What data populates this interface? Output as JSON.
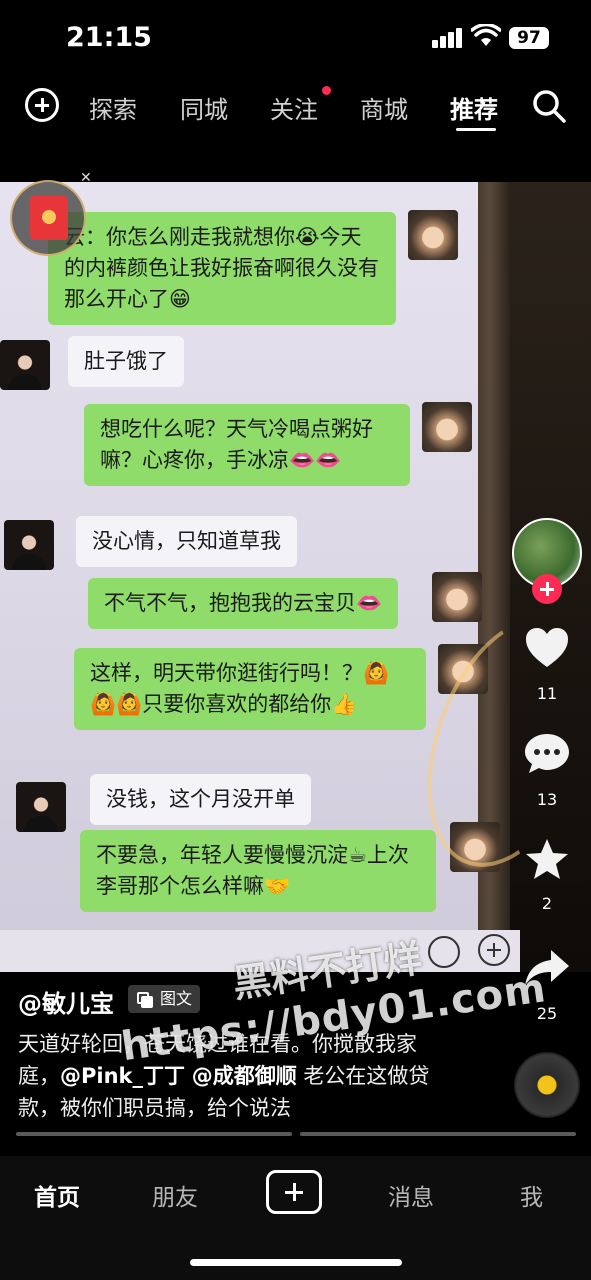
{
  "status_bar": {
    "time": "21:15",
    "battery": "97"
  },
  "top_nav": {
    "tabs": [
      "探索",
      "同城",
      "关注",
      "商城",
      "推荐"
    ],
    "active_tab": "推荐"
  },
  "chat": {
    "messages": [
      {
        "side": "right",
        "text": "云：你怎么刚走我就想你😭今天的内裤颜色让我好振奋啊很久没有那么开心了😁"
      },
      {
        "side": "left",
        "text": "肚子饿了"
      },
      {
        "side": "right",
        "text": "想吃什么呢？天气冷喝点粥好嘛？心疼你，手冰凉👄👄"
      },
      {
        "side": "left",
        "text": "没心情，只知道草我"
      },
      {
        "side": "right",
        "text": "不气不气，抱抱我的云宝贝👄"
      },
      {
        "side": "right",
        "text": "这样，明天带你逛街行吗！？🙆🙆🙆只要你喜欢的都给你👍"
      },
      {
        "side": "left",
        "text": "没钱，这个月没开单"
      },
      {
        "side": "right",
        "text": "不要急，年轻人要慢慢沉淀☕上次李哥那个怎么样嘛🤝"
      }
    ]
  },
  "actions": {
    "likes": "11",
    "comments": "13",
    "favorites": "2",
    "shares": "25"
  },
  "post": {
    "author": "@敏儿宝",
    "tag": "图文",
    "caption_1": "天道好轮回，",
    "caption_2": "苍天饶过谁在看。你搅散我家庭，",
    "mention_1": "@Pink_丁丁",
    "mention_2": "@成都御顺",
    "caption_3": "老公在这做贷款，被你们职员搞，给个说法"
  },
  "watermark": {
    "line1": "黑料不打烊",
    "line2": "https://bdy01.com"
  },
  "bottom_nav": {
    "home": "首页",
    "friends": "朋友",
    "messages": "消息",
    "me": "我"
  },
  "colors": {
    "accent": "#fe2c55",
    "bubble_green": "#8fdc6a",
    "disc_center": "#f2c318"
  }
}
